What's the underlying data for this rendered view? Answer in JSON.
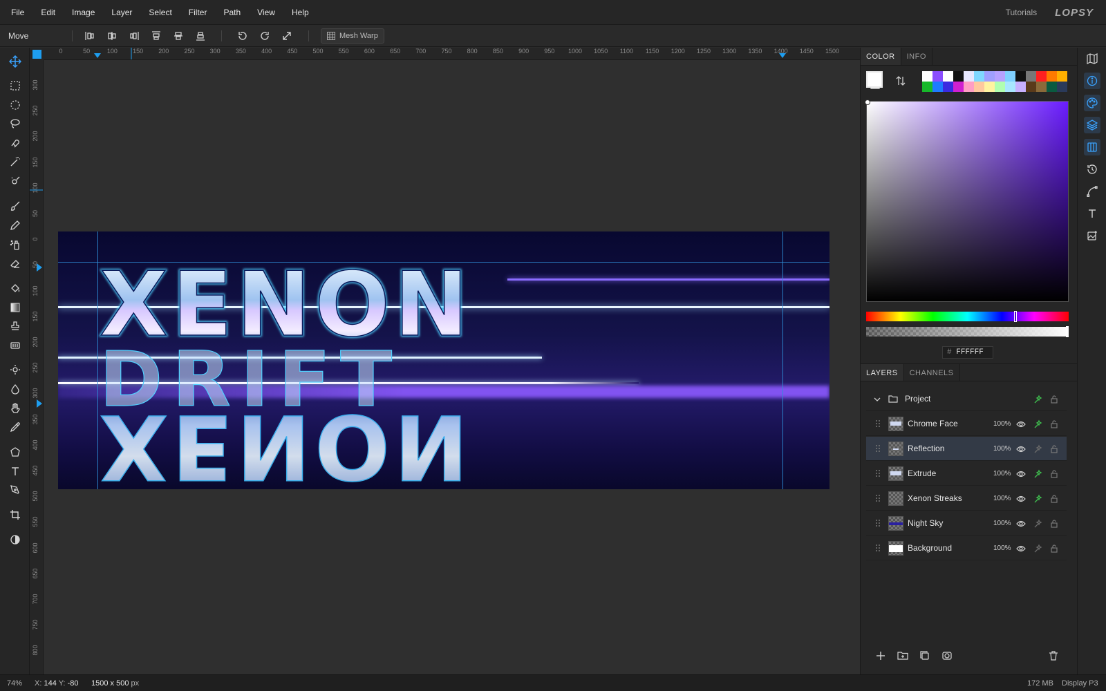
{
  "menu": [
    "File",
    "Edit",
    "Image",
    "Layer",
    "Select",
    "Filter",
    "Path",
    "View",
    "Help"
  ],
  "topright": {
    "tutorials": "Tutorials",
    "logo": "LOPSY"
  },
  "options": {
    "tool_name": "Move",
    "mesh_warp": "Mesh Warp"
  },
  "ruler_h": [
    "0",
    "50",
    "100",
    "150",
    "200",
    "250",
    "300",
    "350",
    "400",
    "450",
    "500",
    "550",
    "600",
    "650",
    "700",
    "750",
    "800",
    "850",
    "900",
    "950",
    "1000",
    "1050",
    "1100",
    "1150",
    "1200",
    "1250",
    "1300",
    "1350",
    "1400",
    "1450",
    "1500"
  ],
  "ruler_v": [
    "300",
    "250",
    "200",
    "150",
    "100",
    "50",
    "0",
    "50",
    "100",
    "150",
    "200",
    "250",
    "300",
    "350",
    "400",
    "450",
    "500",
    "550",
    "600",
    "650",
    "700",
    "750",
    "800"
  ],
  "artwork": {
    "top_text": "XENON",
    "mid_text": "DRIFT",
    "reflection_text": "XENON"
  },
  "color_panel": {
    "tabs": [
      "COLOR",
      "INFO"
    ],
    "hex_prefix": "#",
    "hex": "FFFFFF",
    "palette": [
      "#ffffff",
      "#8b4dff",
      "#ffffff",
      "#111111",
      "#e8e8ff",
      "#7fd8ff",
      "#9f9fff",
      "#b6a1ff",
      "#7fd0ff",
      "#111111",
      "#777777",
      "#ff2020",
      "#ff7a00",
      "#ffb000",
      "#17b82a",
      "#1e7bff",
      "#3b2be0",
      "#d020d0",
      "#ff9ec4",
      "#ffc89e",
      "#fff3a0",
      "#b0ffb0",
      "#a8e6ff",
      "#c8b0ff",
      "#5a3a1a",
      "#8a6a3a",
      "#0a5a40",
      "#2a3a5a"
    ]
  },
  "layers_panel": {
    "tabs": [
      "LAYERS",
      "CHANNELS"
    ],
    "group": "Project",
    "layers": [
      {
        "name": "Chrome Face",
        "opacity": "100%"
      },
      {
        "name": "Reflection",
        "opacity": "100%"
      },
      {
        "name": "Extrude",
        "opacity": "100%"
      },
      {
        "name": "Xenon Streaks",
        "opacity": "100%"
      },
      {
        "name": "Night Sky",
        "opacity": "100%"
      },
      {
        "name": "Background",
        "opacity": "100%"
      }
    ]
  },
  "status": {
    "zoom": "74%",
    "x_label": "X:",
    "x": "144",
    "y_label": "Y:",
    "y": "-80",
    "size": "1500 x 500",
    "unit": "px",
    "memory": "172 MB",
    "profile": "Display P3"
  }
}
